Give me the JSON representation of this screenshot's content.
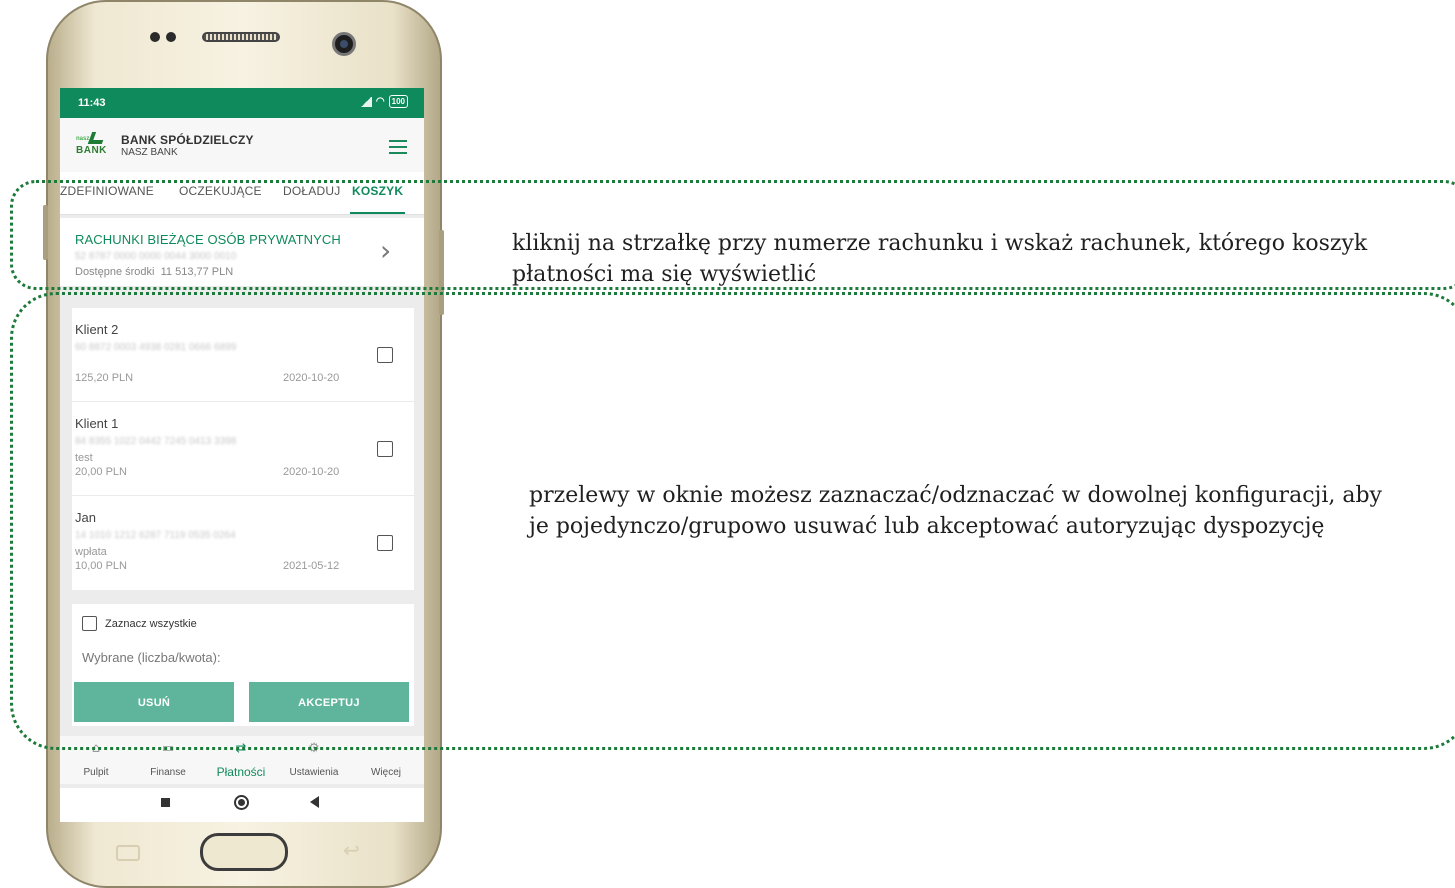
{
  "status_bar": {
    "time": "11:43",
    "battery": "100"
  },
  "app_bar": {
    "brand_small": "nasz",
    "brand_logo_word": "BANK",
    "brand_name": "BANK SPÓŁDZIELCZY",
    "brand_sub": "NASZ BANK",
    "menu_icon": "hamburger-icon"
  },
  "tabs": [
    {
      "label": "ZDEFINIOWANE",
      "active": false
    },
    {
      "label": "OCZEKUJĄCE",
      "active": false
    },
    {
      "label": "DOŁADUJ",
      "active": false
    },
    {
      "label": "KOSZYK",
      "active": true
    }
  ],
  "account": {
    "name": "RACHUNKI BIEŻĄCE OSÓB PRYWATNYCH",
    "number": "52 8787 0000 0000 0044 3000 0010",
    "funds_label": "Dostępne środki",
    "funds_value": "11 513,77 PLN"
  },
  "transfers": [
    {
      "name": "Klient 2",
      "account": "60 8872 0003 4938 0281 0666 6899",
      "description": "",
      "amount": "125,20 PLN",
      "date": "2020-10-20",
      "checked": false
    },
    {
      "name": "Klient 1",
      "account": "84 8355 1022 0442 7245 0413 3398",
      "description": "test",
      "amount": "20,00 PLN",
      "date": "2020-10-20",
      "checked": false
    },
    {
      "name": "Jan",
      "account": "14 1010 1212 6287 7119 0535 0264",
      "description": "wpłata",
      "amount": "10,00 PLN",
      "date": "2021-05-12",
      "checked": false
    }
  ],
  "basket": {
    "select_all_label": "Zaznacz wszystkie",
    "selected_summary": "Wybrane (liczba/kwota):",
    "delete_label": "USUŃ",
    "accept_label": "AKCEPTUJ"
  },
  "bottom_nav": [
    {
      "label": "Pulpit",
      "icon": "home-icon",
      "active": false
    },
    {
      "label": "Finanse",
      "icon": "wallet-icon",
      "active": false
    },
    {
      "label": "Płatności",
      "icon": "payments-icon",
      "active": true
    },
    {
      "label": "Ustawienia",
      "icon": "gear-icon",
      "active": false
    },
    {
      "label": "Więcej",
      "icon": "more-icon",
      "active": false
    }
  ],
  "annotations": {
    "top": "kliknij na strzałkę przy numerze rachunku i wskaż rachunek, którego koszyk płatności ma się wyświetlić",
    "bottom": "przelewy w oknie możesz zaznaczać/odznaczać w dowolnej konfiguracji, aby je pojedynczo/grupowo usuwać lub akceptować autoryzując dyspozycję"
  },
  "colors": {
    "accent": "#0f8a5c",
    "button": "#5fb59b",
    "callout": "#1c7a3a"
  }
}
